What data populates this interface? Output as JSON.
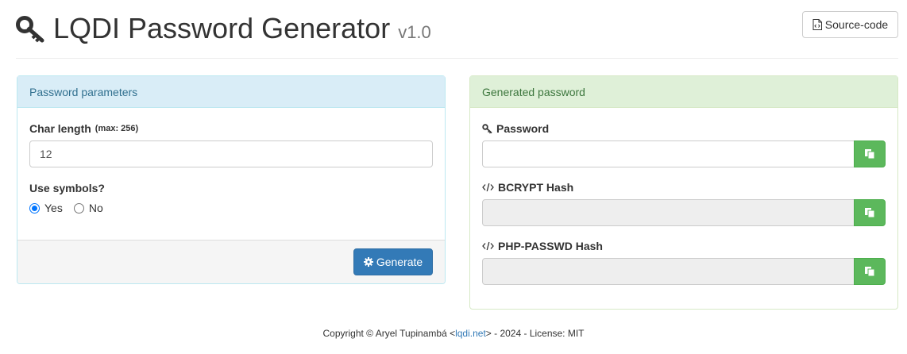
{
  "header": {
    "title": "LQDI Password Generator",
    "version": "v1.0",
    "source_button_label": "Source-code",
    "title_icon": "key-icon",
    "source_icon": "code-file-icon"
  },
  "params_panel": {
    "heading": "Password parameters",
    "char_length_label": "Char length",
    "char_length_hint": "(max: 256)",
    "char_length_value": "12",
    "symbols_label": "Use symbols?",
    "options": [
      "Yes",
      "No"
    ],
    "selected_option": "Yes",
    "generate_label": "Generate",
    "generate_icon": "gear-icon"
  },
  "result_panel": {
    "heading": "Generated password",
    "password_label": "Password",
    "password_value": "",
    "bcrypt_label": "BCRYPT Hash",
    "bcrypt_value": "",
    "phppasswd_label": "PHP-PASSWD Hash",
    "phppasswd_value": "",
    "copy_icon": "copy-icon"
  },
  "footer": {
    "prefix": "Copyright © Aryel Tupinambá <",
    "link_text": "lqdi.net",
    "suffix": "> - 2024 - License: MIT"
  },
  "colors": {
    "info_heading_bg": "#d9edf7",
    "success_heading_bg": "#dff0d8",
    "primary": "#337ab7",
    "success": "#5cb85c"
  }
}
